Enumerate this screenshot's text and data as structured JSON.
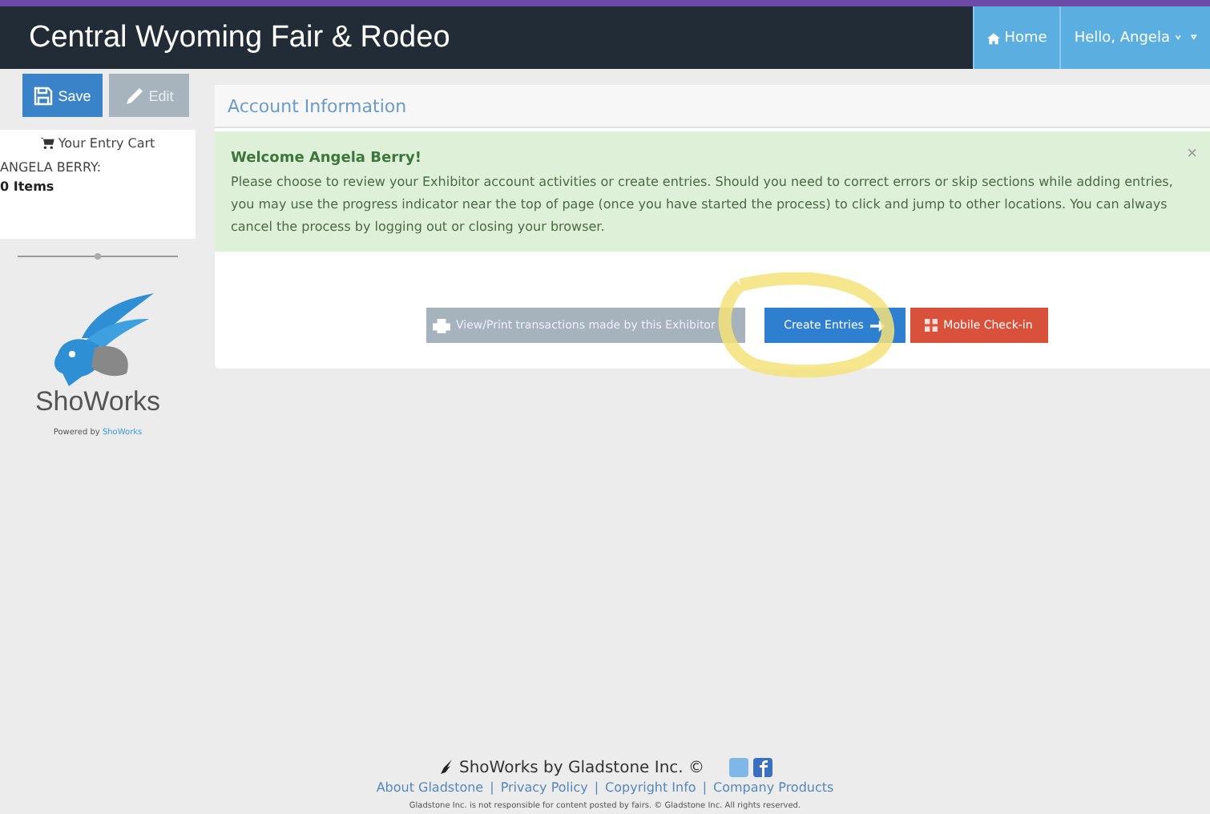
{
  "header": {
    "title": "Central Wyoming Fair & Rodeo",
    "nav": [
      {
        "label": "Home",
        "kind": "home"
      },
      {
        "label": "Hello, Angela",
        "kind": "menu"
      }
    ]
  },
  "sidebar": {
    "buttons": [
      {
        "label": "Save",
        "disabled": false
      },
      {
        "label": "Edit",
        "disabled": true
      }
    ],
    "cart": {
      "title": "Your Entry Cart",
      "owner": "ANGELA BERRY:",
      "count": "0 Items"
    },
    "logo": "ShoWorks",
    "powered_prefix": "Powered by",
    "powered_link": "ShoWorks"
  },
  "panel": {
    "title": "Account Information",
    "alert": {
      "title": "Welcome Angela Berry!",
      "close": "×",
      "body": "Please choose to review your Exhibitor account activities or create entries. Should you need to correct errors or skip sections while adding entries, you may use the progress indicator near the top of page (once you have started the process) to click and jump to other locations. You can always cancel the process by logging out or closing your browser."
    },
    "actions": [
      {
        "label": "View/Print transactions made by this Exhibitor",
        "kind": "print"
      },
      {
        "label": "Create Entries",
        "kind": "create"
      },
      {
        "label": "Mobile Check-in",
        "kind": "mobile"
      }
    ]
  },
  "footer": {
    "brand": "ShoWorks by Gladstone Inc. ©",
    "links": [
      "About Gladstone",
      "Privacy Policy",
      "Copyright Info",
      "Company Products"
    ],
    "separator": "|",
    "notice": "Gladstone Inc. is not responsible for content posted by fairs. © Gladstone Inc. All rights reserved."
  }
}
